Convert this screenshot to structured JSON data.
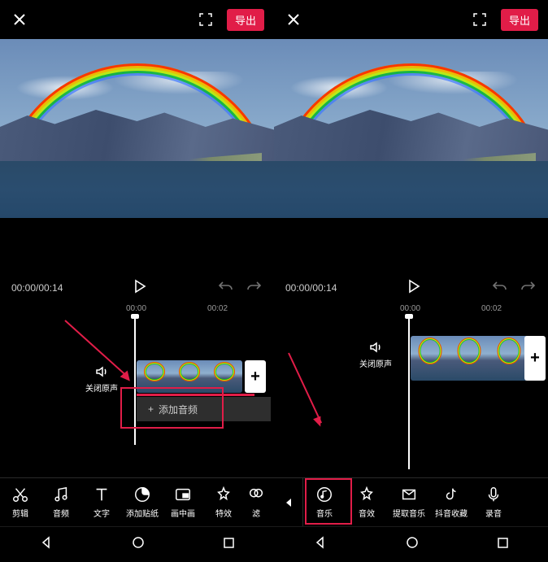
{
  "common": {
    "export": "导出",
    "time": "00:00/00:14",
    "ruler": [
      "00:00",
      "00:02"
    ],
    "mute_label": "关闭原声",
    "nav": {
      "back": "◁",
      "home": "○",
      "recent": "□"
    }
  },
  "screen1": {
    "add_audio": "添加音频",
    "tools": [
      {
        "id": "cut",
        "label": "剪辑"
      },
      {
        "id": "audio",
        "label": "音频"
      },
      {
        "id": "text",
        "label": "文字"
      },
      {
        "id": "sticker",
        "label": "添加贴纸"
      },
      {
        "id": "pip",
        "label": "画中画"
      },
      {
        "id": "effect",
        "label": "特效"
      },
      {
        "id": "filter",
        "label": "滤"
      }
    ]
  },
  "screen2": {
    "tools": [
      {
        "id": "music",
        "label": "音乐"
      },
      {
        "id": "sfx",
        "label": "音效"
      },
      {
        "id": "extract",
        "label": "提取音乐"
      },
      {
        "id": "douyin",
        "label": "抖音收藏"
      },
      {
        "id": "record",
        "label": "录音"
      }
    ]
  }
}
